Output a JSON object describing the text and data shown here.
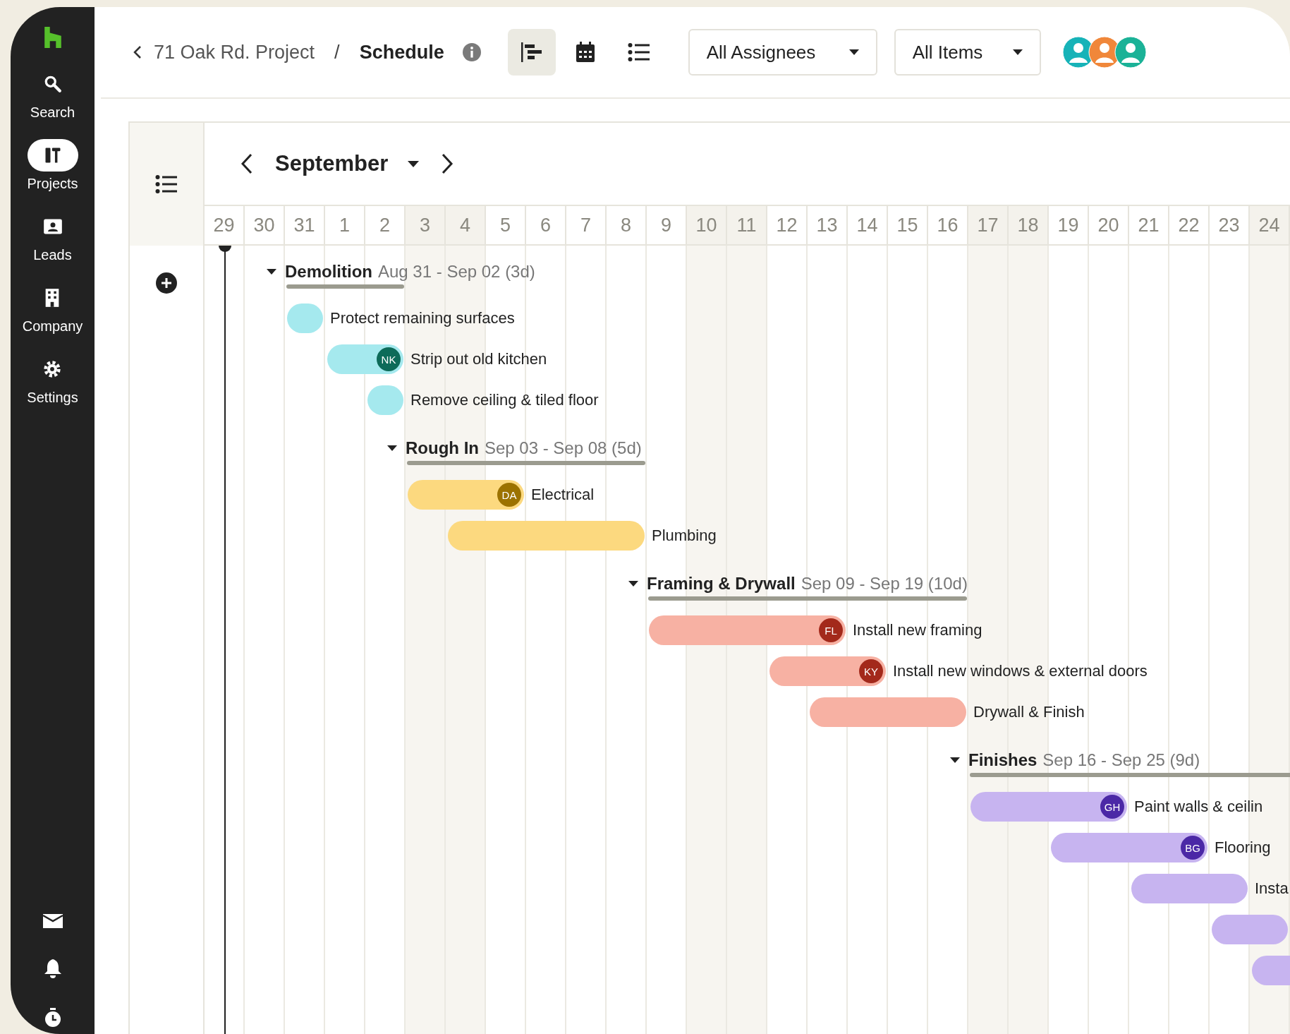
{
  "sidebar": {
    "items": [
      {
        "label": "Search",
        "selected": false
      },
      {
        "label": "Projects",
        "selected": true
      },
      {
        "label": "Leads",
        "selected": false
      },
      {
        "label": "Company",
        "selected": false
      },
      {
        "label": "Settings",
        "selected": false
      }
    ]
  },
  "header": {
    "back_label": "71 Oak Rd. Project",
    "separator": "/",
    "title": "Schedule",
    "views": [
      {
        "selected": true
      },
      {
        "selected": false
      },
      {
        "selected": false
      }
    ],
    "filters": [
      "All Assignees",
      "All Items"
    ],
    "team_avatars": [
      {
        "color": "#17b3b8"
      },
      {
        "color": "#f0873a"
      },
      {
        "color": "#1bb297"
      }
    ]
  },
  "gantt": {
    "month": "September",
    "days": [
      {
        "label": "29",
        "weekend": false
      },
      {
        "label": "30",
        "weekend": false
      },
      {
        "label": "31",
        "weekend": false
      },
      {
        "label": "1",
        "weekend": false
      },
      {
        "label": "2",
        "weekend": false
      },
      {
        "label": "3",
        "weekend": true
      },
      {
        "label": "4",
        "weekend": true
      },
      {
        "label": "5",
        "weekend": false
      },
      {
        "label": "6",
        "weekend": false
      },
      {
        "label": "7",
        "weekend": false
      },
      {
        "label": "8",
        "weekend": false
      },
      {
        "label": "9",
        "weekend": false
      },
      {
        "label": "10",
        "weekend": true
      },
      {
        "label": "11",
        "weekend": true
      },
      {
        "label": "12",
        "weekend": false
      },
      {
        "label": "13",
        "weekend": false
      },
      {
        "label": "14",
        "weekend": false
      },
      {
        "label": "15",
        "weekend": false
      },
      {
        "label": "16",
        "weekend": false
      },
      {
        "label": "17",
        "weekend": true
      },
      {
        "label": "18",
        "weekend": true
      },
      {
        "label": "19",
        "weekend": false
      },
      {
        "label": "20",
        "weekend": false
      },
      {
        "label": "21",
        "weekend": false
      },
      {
        "label": "22",
        "weekend": false
      },
      {
        "label": "23",
        "weekend": false
      },
      {
        "label": "24",
        "weekend": true
      }
    ],
    "groups": [
      {
        "name": "Demolition",
        "dates": "Aug 31 - Sep 02 (3d)",
        "expanded": true,
        "color": "#a5e9ee",
        "tasks": [
          {
            "name": "Protect remaining surfaces"
          },
          {
            "name": "Strip out old kitchen",
            "assignee": {
              "initials": "NK",
              "color": "#0d6b59"
            }
          },
          {
            "name": "Remove ceiling & tiled floor"
          }
        ]
      },
      {
        "name": "Rough In",
        "dates": "Sep 03 - Sep 08 (5d)",
        "expanded": true,
        "color": "#fcd97f",
        "tasks": [
          {
            "name": "Electrical",
            "assignee": {
              "initials": "DA",
              "color": "#9c7200"
            }
          },
          {
            "name": "Plumbing"
          }
        ]
      },
      {
        "name": "Framing & Drywall",
        "dates": "Sep 09 - Sep 19 (10d)",
        "expanded": true,
        "color": "#f7b1a3",
        "tasks": [
          {
            "name": "Install new framing",
            "assignee": {
              "initials": "FL",
              "color": "#a3291b"
            }
          },
          {
            "name": "Install new windows & external doors",
            "assignee": {
              "initials": "KY",
              "color": "#a3291b"
            }
          },
          {
            "name": "Drywall & Finish"
          }
        ]
      },
      {
        "name": "Finishes",
        "dates": "Sep 16 - Sep 25 (9d)",
        "expanded": true,
        "color": "#c7b4f0",
        "tasks": [
          {
            "name": "Paint walls & ceilin",
            "assignee": {
              "initials": "GH",
              "color": "#4b28a6"
            }
          },
          {
            "name": "Flooring",
            "assignee": {
              "initials": "BG",
              "color": "#4b28a6"
            }
          },
          {
            "name": "Insta"
          }
        ]
      }
    ]
  }
}
